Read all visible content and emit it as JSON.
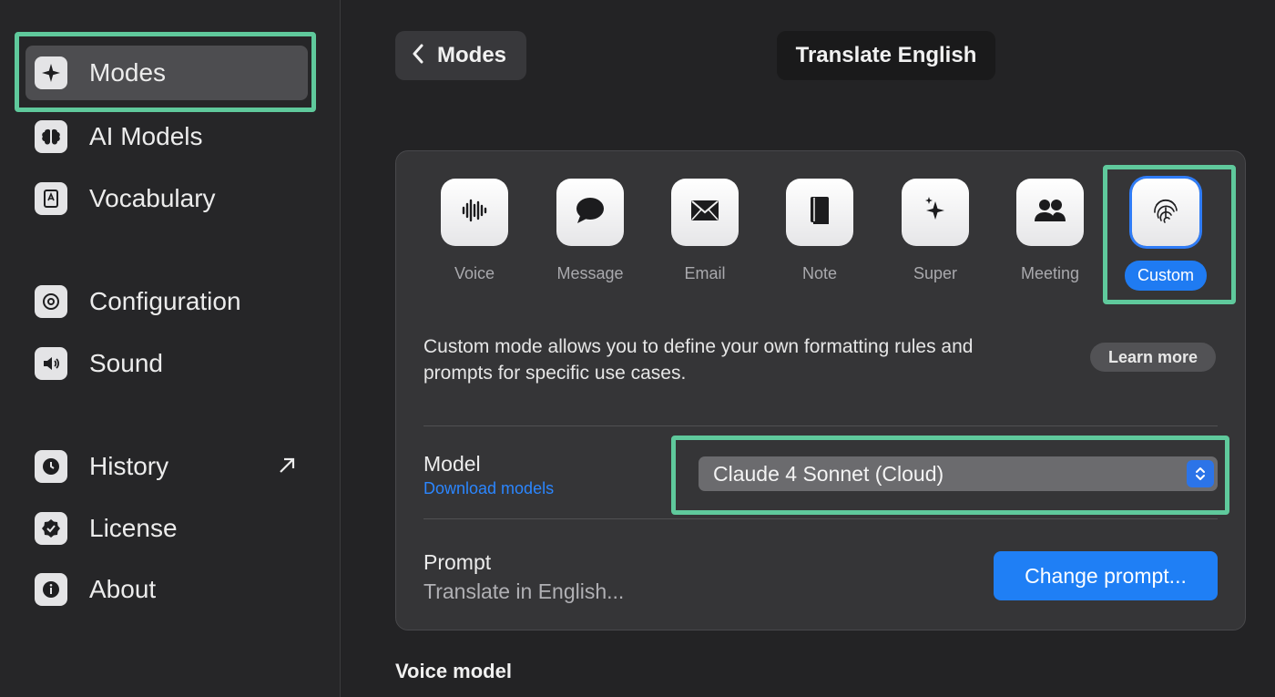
{
  "sidebar": {
    "items": [
      {
        "label": "Modes",
        "icon": "sparkle-icon"
      },
      {
        "label": "AI Models",
        "icon": "brain-icon"
      },
      {
        "label": "Vocabulary",
        "icon": "book-icon"
      },
      {
        "label": "Configuration",
        "icon": "gear-icon"
      },
      {
        "label": "Sound",
        "icon": "speaker-icon"
      },
      {
        "label": "History",
        "icon": "clock-icon"
      },
      {
        "label": "License",
        "icon": "badge-check-icon"
      },
      {
        "label": "About",
        "icon": "info-icon"
      }
    ],
    "history_external_icon": "arrow-up-right-icon"
  },
  "header": {
    "back_label": "Modes",
    "title": "Translate English"
  },
  "modes": [
    {
      "label": "Voice",
      "icon": "waveform-icon"
    },
    {
      "label": "Message",
      "icon": "speech-bubble-icon"
    },
    {
      "label": "Email",
      "icon": "envelope-icon"
    },
    {
      "label": "Note",
      "icon": "notebook-icon"
    },
    {
      "label": "Super",
      "icon": "sparkles-icon"
    },
    {
      "label": "Meeting",
      "icon": "people-icon"
    },
    {
      "label": "Custom",
      "icon": "fingerprint-icon"
    }
  ],
  "selected_mode": "Custom",
  "description": {
    "line1": "Custom mode allows you to define your own formatting rules and",
    "line2": "prompts for specific use cases.",
    "learn_more": "Learn more"
  },
  "model": {
    "title": "Model",
    "download_link": "Download models",
    "selected": "Claude 4 Sonnet (Cloud)"
  },
  "prompt": {
    "title": "Prompt",
    "value": "Translate in English...",
    "button": "Change prompt..."
  },
  "voice_model_title": "Voice model",
  "colors": {
    "accent": "#1f7bf2",
    "highlight": "#5fc99c",
    "background": "#232325"
  }
}
